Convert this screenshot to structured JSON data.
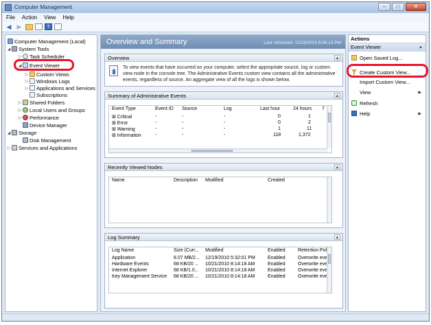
{
  "window": {
    "title": "Computer Management",
    "min": "–",
    "max": "□",
    "close": "✕"
  },
  "menu": [
    "File",
    "Action",
    "View",
    "Help"
  ],
  "toolbar": {
    "back": "◀",
    "forward": "▶",
    "help": "?"
  },
  "tree": {
    "root": "Computer Management (Local)",
    "system_tools": "System Tools",
    "task_scheduler": "Task Scheduler",
    "event_viewer": "Event Viewer",
    "custom_views": "Custom Views",
    "windows_logs": "Windows Logs",
    "app_services_logs": "Applications and Services Logs",
    "subscriptions": "Subscriptions",
    "shared_folders": "Shared Folders",
    "local_users": "Local Users and Groups",
    "performance": "Performance",
    "device_manager": "Device Manager",
    "storage": "Storage",
    "disk_management": "Disk Management",
    "services_apps": "Services and Applications",
    "expanded_glyph": "◢",
    "collapsed_glyph": "▷"
  },
  "center": {
    "title": "Overview and Summary",
    "last_refreshed": "Last refreshed: 12/19/2010 6:06:13 PM",
    "overview": {
      "header": "Overview",
      "text": "To view events that have occurred on your computer, select the appropriate source, log or custom view node in the console tree. The Administrative Events custom view contains all the administrative events, regardless of source. An aggregate view of all the logs is shown below."
    },
    "admin_events": {
      "header": "Summary of Administrative Events",
      "columns": [
        "Event Type",
        "Event ID",
        "Source",
        "Log",
        "Last hour",
        "24 hours",
        "7"
      ],
      "rows": [
        [
          "⊞ Critical",
          "-",
          "-",
          "-",
          "0",
          "1"
        ],
        [
          "⊞ Error",
          "-",
          "-",
          "-",
          "0",
          "2"
        ],
        [
          "⊞ Warning",
          "-",
          "-",
          "-",
          "1",
          "11"
        ],
        [
          "⊞ Information",
          "-",
          "-",
          "-",
          "118",
          "1,372"
        ]
      ]
    },
    "recent_nodes": {
      "header": "Recently Viewed Nodes",
      "columns": [
        "Name",
        "Description",
        "Modified",
        "Created"
      ]
    },
    "log_summary": {
      "header": "Log Summary",
      "columns": [
        "Log Name",
        "Size (Curr...",
        "Modified",
        "Enabled",
        "Retention Polic"
      ],
      "rows": [
        [
          "Application",
          "8.07 MB/2...",
          "12/19/2010 5:32:01 PM",
          "Enabled",
          "Overwrite even"
        ],
        [
          "Hardware Events",
          "68 KB/20 ...",
          "10/21/2010 8:14:18 AM",
          "Enabled",
          "Overwrite even"
        ],
        [
          "Internet Explorer",
          "68 KB/1.0...",
          "10/21/2010 8:14:18 AM",
          "Enabled",
          "Overwrite even"
        ],
        [
          "Key Management Service",
          "68 KB/20 ...",
          "10/21/2010 8:14:18 AM",
          "Enabled",
          "Overwrite even"
        ]
      ]
    },
    "caret": "▲"
  },
  "actions": {
    "title": "Actions",
    "subheader": "Event Viewer",
    "subheader_caret": "▲",
    "items": {
      "open_saved": "Open Saved Log...",
      "create_custom": "Create Custom View...",
      "import_custom": "Import Custom View...",
      "view": "View",
      "refresh": "Refresh",
      "help": "Help"
    },
    "submenu_arrow": "▶"
  }
}
